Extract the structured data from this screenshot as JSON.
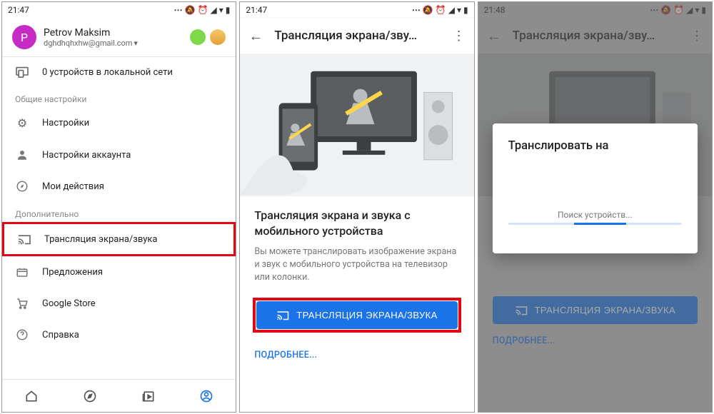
{
  "status_time_a": "21:47",
  "status_time_b": "21:47",
  "status_time_c": "21:48",
  "s1": {
    "avatar_letter": "P",
    "user_name": "Petrov Maksim",
    "user_email": "dghdhqhxhw@gmail.com",
    "devices_row": "0 устройств в локальной сети",
    "section_general": "Общие настройки",
    "item_settings": "Настройки",
    "item_account": "Настройки аккаунта",
    "item_activity": "Мои действия",
    "section_more": "Дополнительно",
    "item_cast": "Трансляция экрана/звука",
    "item_offers": "Предложения",
    "item_store": "Google Store",
    "item_help": "Справка"
  },
  "s2": {
    "title": "Трансляция экрана/зву…",
    "headline": "Трансляция экрана и звука с мобильного устройства",
    "desc": "Вы можете транслировать изображение экрана и звук с мобильного устройства на телевизор или колонки.",
    "button": "ТРАНСЛЯЦИЯ ЭКРАНА/ЗВУКА",
    "more": "ПОДРОБНЕЕ..."
  },
  "s3": {
    "title": "Трансляция экрана/зву…",
    "button": "ТРАНСЛЯЦИЯ ЭКРАНА/ЗВУКА",
    "more": "ПОДРОБНЕЕ...",
    "modal_title": "Транслировать на",
    "searching": "Поиск устройств..."
  }
}
